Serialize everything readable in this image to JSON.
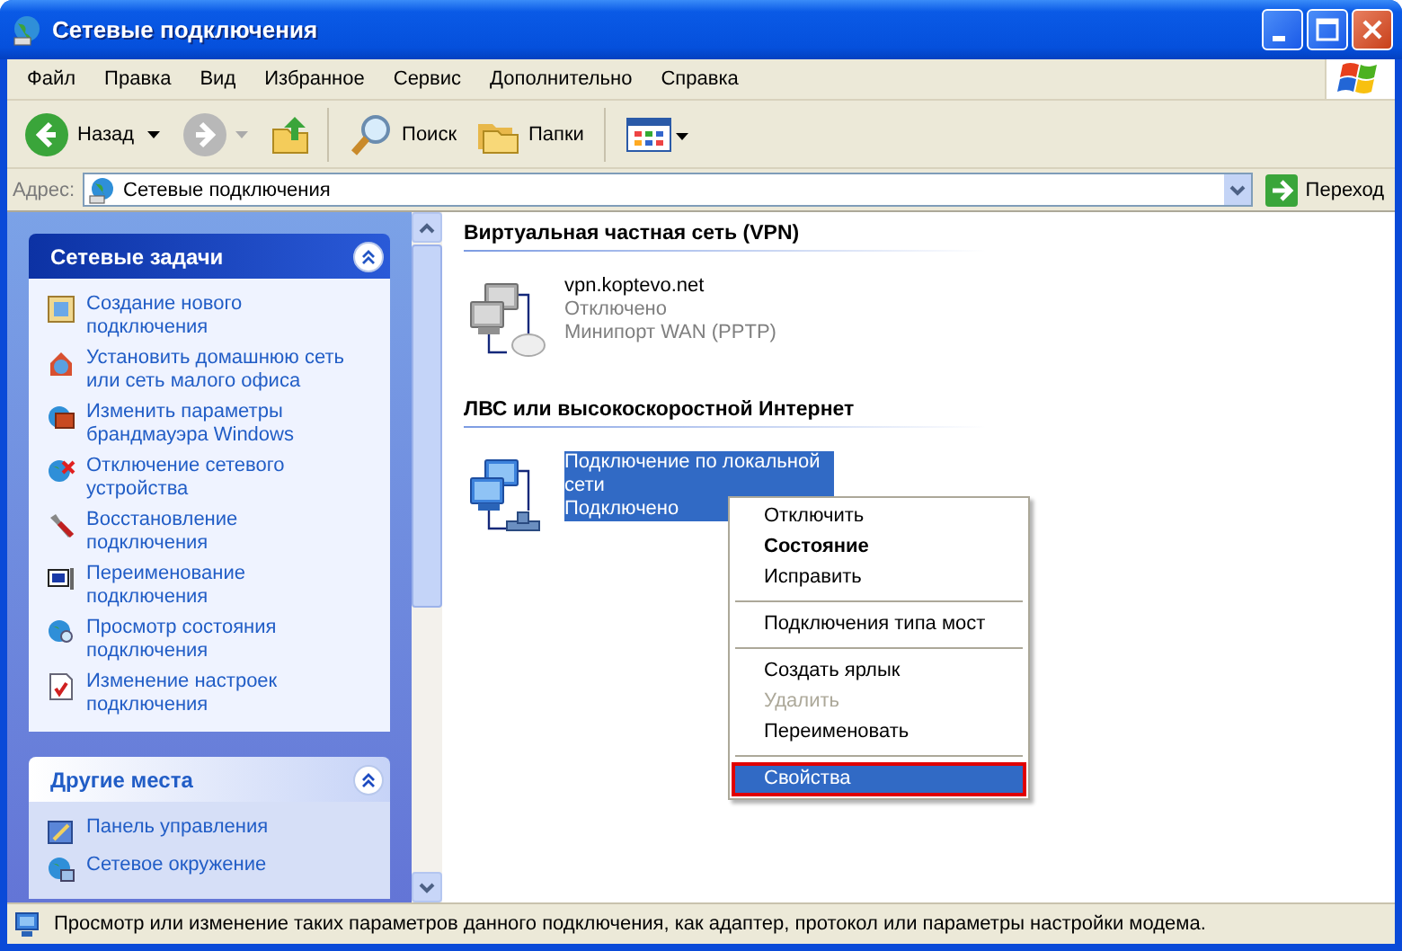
{
  "window": {
    "title": "Сетевые подключения"
  },
  "menu_bar": [
    "Файл",
    "Правка",
    "Вид",
    "Избранное",
    "Сервис",
    "Дополнительно",
    "Справка"
  ],
  "toolbar": {
    "back": "Назад",
    "search": "Поиск",
    "folders": "Папки"
  },
  "address_bar": {
    "label": "Адрес:",
    "value": "Сетевые подключения",
    "go": "Переход"
  },
  "task_panels": [
    {
      "title": "Сетевые задачи",
      "kind": "primary",
      "items": [
        "Создание нового подключения",
        "Установить домашнюю сеть или сеть малого офиса",
        "Изменить параметры брандмауэра Windows",
        "Отключение сетевого устройства",
        "Восстановление подключения",
        "Переименование подключения",
        "Просмотр состояния подключения",
        "Изменение настроек подключения"
      ]
    },
    {
      "title": "Другие места",
      "kind": "secondary",
      "items": [
        "Панель управления",
        "Сетевое окружение"
      ]
    }
  ],
  "groups": [
    {
      "title": "Виртуальная частная сеть (VPN)",
      "connections": [
        {
          "name": "vpn.koptevo.net",
          "status": "Отключено",
          "device": "Минипорт WAN (PPTP)",
          "connected": false,
          "selected": false
        }
      ]
    },
    {
      "title": "ЛВС или высокоскоростной Интернет",
      "connections": [
        {
          "name": "Подключение по локальной сети",
          "status": "Подключено",
          "connected": true,
          "selected": true
        }
      ]
    }
  ],
  "context_menu": [
    {
      "kind": "item",
      "label": "Отключить",
      "default": false,
      "disabled": false,
      "selected": false
    },
    {
      "kind": "item",
      "label": "Состояние",
      "default": true,
      "disabled": false,
      "selected": false
    },
    {
      "kind": "item",
      "label": "Исправить",
      "default": false,
      "disabled": false,
      "selected": false
    },
    {
      "kind": "separator"
    },
    {
      "kind": "item",
      "label": "Подключения типа мост",
      "default": false,
      "disabled": false,
      "selected": false
    },
    {
      "kind": "separator"
    },
    {
      "kind": "item",
      "label": "Создать ярлык",
      "default": false,
      "disabled": false,
      "selected": false
    },
    {
      "kind": "item",
      "label": "Удалить",
      "default": false,
      "disabled": true,
      "selected": false
    },
    {
      "kind": "item",
      "label": "Переименовать",
      "default": false,
      "disabled": false,
      "selected": false
    },
    {
      "kind": "separator"
    },
    {
      "kind": "item",
      "label": "Свойства",
      "default": false,
      "disabled": false,
      "selected": true
    }
  ],
  "status_bar": "Просмотр или изменение таких параметров данного подключения, как адаптер, протокол или параметры настройки модема."
}
